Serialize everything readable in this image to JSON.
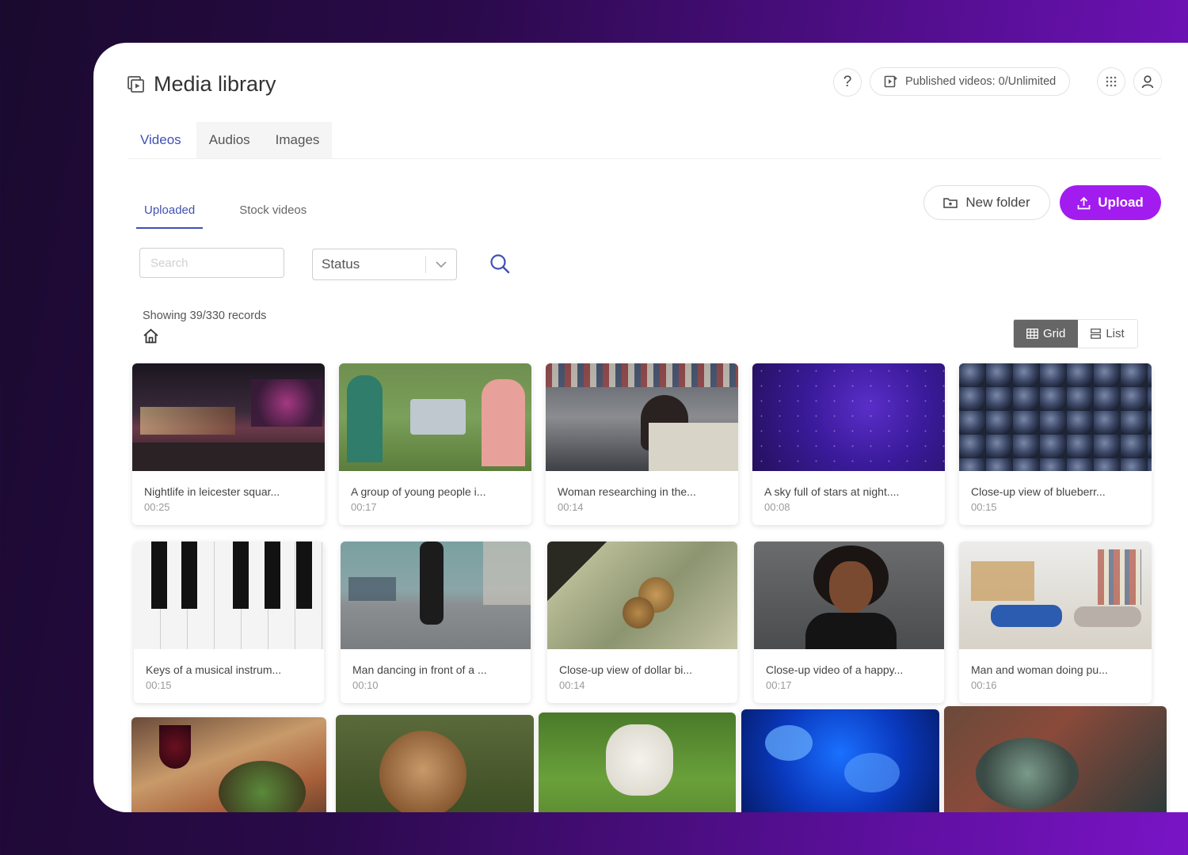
{
  "header": {
    "title": "Media library",
    "help_label": "?",
    "published_label": "Published videos: 0/Unlimited"
  },
  "main_tabs": [
    {
      "label": "Videos",
      "active": true
    },
    {
      "label": "Audios",
      "active": false
    },
    {
      "label": "Images",
      "active": false
    }
  ],
  "sub_tabs": [
    {
      "label": "Uploaded",
      "active": true
    },
    {
      "label": "Stock videos",
      "active": false
    }
  ],
  "actions": {
    "new_folder_label": "New folder",
    "upload_label": "Upload"
  },
  "filters": {
    "search_placeholder": "Search",
    "status_label": "Status"
  },
  "records_text": "Showing 39/330 records",
  "view_toggle": {
    "grid_label": "Grid",
    "list_label": "List",
    "selected": "Grid"
  },
  "colors": {
    "accent": "#3f51b5",
    "upload": "#a21cf0",
    "background_gradient_end": "#7a14c6"
  },
  "videos": [
    {
      "title": "Nightlife in leicester squar...",
      "duration": "00:25",
      "icon": "thumbnail-city-night"
    },
    {
      "title": "A group of young people i...",
      "duration": "00:17",
      "icon": "thumbnail-people-park"
    },
    {
      "title": "Woman researching in the...",
      "duration": "00:14",
      "icon": "thumbnail-library"
    },
    {
      "title": "A sky full of stars at night....",
      "duration": "00:08",
      "icon": "thumbnail-stars"
    },
    {
      "title": "Close-up view of blueberr...",
      "duration": "00:15",
      "icon": "thumbnail-blueberries"
    },
    {
      "title": "Keys of a musical instrum...",
      "duration": "00:15",
      "icon": "thumbnail-piano-keys"
    },
    {
      "title": "Man dancing in front of a ...",
      "duration": "00:10",
      "icon": "thumbnail-dancer"
    },
    {
      "title": "Close-up view of dollar bi...",
      "duration": "00:14",
      "icon": "thumbnail-dollar-bills"
    },
    {
      "title": "Close-up video of a happy...",
      "duration": "00:17",
      "icon": "thumbnail-woman-portrait"
    },
    {
      "title": "Man and woman doing pu...",
      "duration": "00:16",
      "icon": "thumbnail-workout"
    }
  ],
  "partial_thumbnails": [
    {
      "icon": "thumbnail-food"
    },
    {
      "icon": "thumbnail-monkey"
    },
    {
      "icon": "thumbnail-dog"
    },
    {
      "icon": "thumbnail-jellyfish"
    },
    {
      "icon": "thumbnail-turtle"
    }
  ]
}
